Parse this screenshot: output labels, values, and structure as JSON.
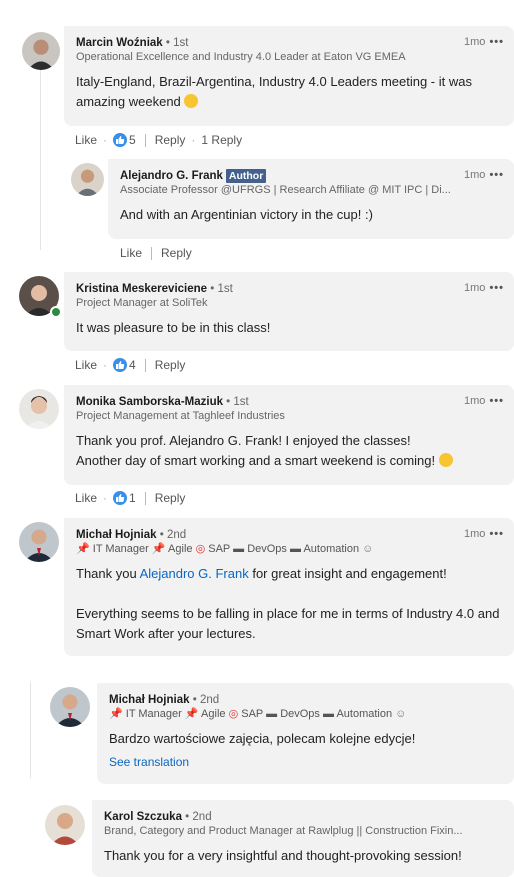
{
  "comments": [
    {
      "name": "Marcin Woźniak",
      "degree": " • 1st",
      "headline": "Operational Excellence and Industry 4.0 Leader at Eaton VG EMEA",
      "time": "1mo",
      "text": "Italy-England, Brazil-Argentina, Industry 4.0 Leaders meeting - it was amazing weekend",
      "like_label": "Like",
      "reaction_count": "5",
      "reply_label": "Reply",
      "replies_count": "1 Reply"
    },
    {
      "name": "Alejandro G. Frank",
      "badge": "Author",
      "headline": "Associate Professor @UFRGS | Research Affiliate @ MIT IPC | Di...",
      "time": "1mo",
      "text": "And with an Argentinian victory in the cup! :)",
      "like_label": "Like",
      "reply_label": "Reply"
    },
    {
      "name": "Kristina Meskereviciene",
      "degree": " • 1st",
      "headline": "Project Manager at SoliTek",
      "time": "1mo",
      "text": "It was pleasure to be in this class!",
      "like_label": "Like",
      "reaction_count": "4",
      "reply_label": "Reply"
    },
    {
      "name": "Monika Samborska-Maziuk",
      "degree": " • 1st",
      "headline": "Project Management at Taghleef Industries",
      "time": "1mo",
      "text_line1": "Thank you prof. Alejandro G. Frank! I enjoyed the classes!",
      "text_line2": "Another day of smart working and a smart weekend is coming!",
      "like_label": "Like",
      "reaction_count": "1",
      "reply_label": "Reply"
    },
    {
      "name": "Michał Hojniak",
      "degree": " • 2nd",
      "tags": [
        "IT Manager",
        "Agile",
        "SAP",
        "DevOps",
        "Automation"
      ],
      "time": "1mo",
      "text_pre": "Thank you ",
      "mention": "Alejandro G. Frank",
      "text_post": " for great insight and engagement!",
      "text_para2": "Everything seems to be falling in place for me in terms of Industry 4.0 and Smart Work after your lectures."
    },
    {
      "name": "Michał Hojniak",
      "degree": " • 2nd",
      "tags": [
        "IT Manager",
        "Agile",
        "SAP",
        "DevOps",
        "Automation"
      ],
      "text": "Bardzo wartościowe zajęcia, polecam kolejne edycje!",
      "see_translation": "See translation"
    },
    {
      "name": "Karol Szczuka",
      "degree": " • 2nd",
      "headline": "Brand, Category and Product Manager at Rawlplug || Construction Fixin...",
      "text": "Thank you for a very insightful and thought-provoking session!"
    }
  ],
  "more_icon": "ellipsis-icon",
  "accent": "#0a66c2"
}
